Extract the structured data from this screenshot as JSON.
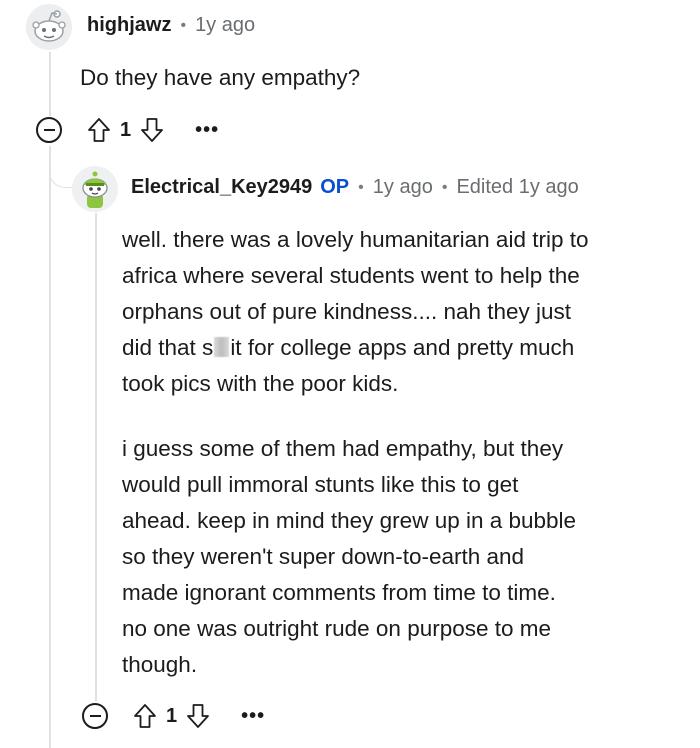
{
  "comment1": {
    "author": "highjawz",
    "time": "1y ago",
    "text": "Do they have any empathy?",
    "vote_count": "1",
    "avatar_icon": "snoo-avatar-icon",
    "more_label": "•••"
  },
  "comment2": {
    "author": "Electrical_Key2949",
    "op_badge": "OP",
    "time": "1y ago",
    "edited": "Edited 1y ago",
    "para1_a": "well. there was a lovely humanitarian aid trip to\nafrica where several students went to help the\norphans out of pure kindness.... nah they just\ndid that s",
    "para1_b": "it for college apps and pretty much\ntook pics with the poor kids.",
    "para2": "i guess some of them had empathy, but they\nwould pull immoral stunts like this to get\nahead. keep in mind they grew up in a bubble\nso they weren't super down-to-earth and\nmade ignorant comments from time to time.\nno one was outright rude on purpose to me\nthough.",
    "vote_count": "1",
    "avatar_icon": "green-snoo-avatar-icon",
    "more_label": "•••"
  },
  "separator": "•",
  "colors": {
    "op": "#0a4fd0",
    "thread_line": "#dfe1e3",
    "text": "#1c1c1c"
  }
}
